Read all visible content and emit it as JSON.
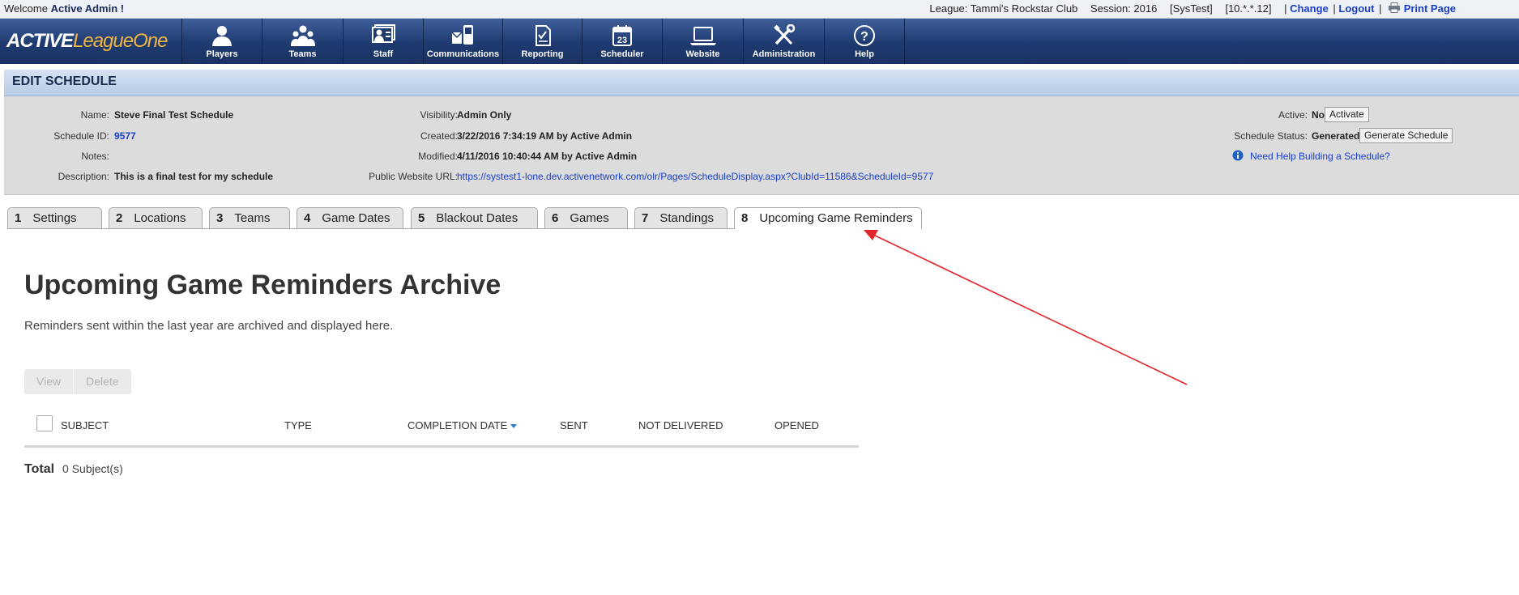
{
  "topbar": {
    "welcome_prefix": "Welcome",
    "user": "Active Admin !",
    "league": "League: Tammi's Rockstar Club",
    "session": "Session: 2016",
    "env": "[SysTest]",
    "ip": "[10.*.*.12]",
    "change": "Change",
    "logout": "Logout",
    "print": "Print Page"
  },
  "logo": {
    "part1": "ACTIVE",
    "part2": "LeagueOne"
  },
  "nav": [
    {
      "label": "Players",
      "icon": "players-icon"
    },
    {
      "label": "Teams",
      "icon": "teams-icon"
    },
    {
      "label": "Staff",
      "icon": "staff-icon"
    },
    {
      "label": "Communications",
      "icon": "communications-icon"
    },
    {
      "label": "Reporting",
      "icon": "reporting-icon"
    },
    {
      "label": "Scheduler",
      "icon": "calendar-icon",
      "day": "23"
    },
    {
      "label": "Website",
      "icon": "laptop-icon"
    },
    {
      "label": "Administration",
      "icon": "tools-icon"
    },
    {
      "label": "Help",
      "icon": "help-icon"
    }
  ],
  "edit_title": "EDIT SCHEDULE",
  "info": {
    "name_label": "Name:",
    "name": "Steve Final Test Schedule",
    "id_label": "Schedule ID:",
    "id": "9577",
    "notes_label": "Notes:",
    "desc_label": "Description:",
    "desc": "This is a final test for my schedule",
    "visibility_label": "Visibility:",
    "visibility": "Admin Only",
    "created_label": "Created:",
    "created": "3/22/2016 7:34:19 AM by Active Admin",
    "modified_label": "Modified:",
    "modified": "4/11/2016 10:40:44 AM by Active Admin",
    "url_label": "Public Website URL:",
    "url": "https://systest1-lone.dev.activenetwork.com/olr/Pages/ScheduleDisplay.aspx?ClubId=11586&ScheduleId=9577",
    "active_label": "Active:",
    "active": "No",
    "activate_btn": "Activate",
    "status_label": "Schedule Status:",
    "status": "Generated",
    "generate_btn": "Generate Schedule",
    "help_link": "Need Help Building a Schedule?"
  },
  "tabs": [
    {
      "num": "1",
      "label": "Settings"
    },
    {
      "num": "2",
      "label": "Locations"
    },
    {
      "num": "3",
      "label": "Teams"
    },
    {
      "num": "4",
      "label": "Game Dates"
    },
    {
      "num": "5",
      "label": "Blackout Dates"
    },
    {
      "num": "6",
      "label": "Games"
    },
    {
      "num": "7",
      "label": "Standings"
    },
    {
      "num": "8",
      "label": "Upcoming Game Reminders"
    }
  ],
  "content": {
    "title": "Upcoming Game Reminders Archive",
    "subtitle": "Reminders sent within the last year are archived and displayed here.",
    "view_btn": "View",
    "delete_btn": "Delete",
    "columns": [
      "SUBJECT",
      "TYPE",
      "COMPLETION DATE",
      "SENT",
      "NOT DELIVERED",
      "OPENED"
    ],
    "total_label": "Total",
    "total_value": "0 Subject(s)"
  },
  "colors": {
    "nav_bg": "#1e3a70",
    "annotation_arrow": "#e0262b",
    "link": "#1a3ec9"
  }
}
